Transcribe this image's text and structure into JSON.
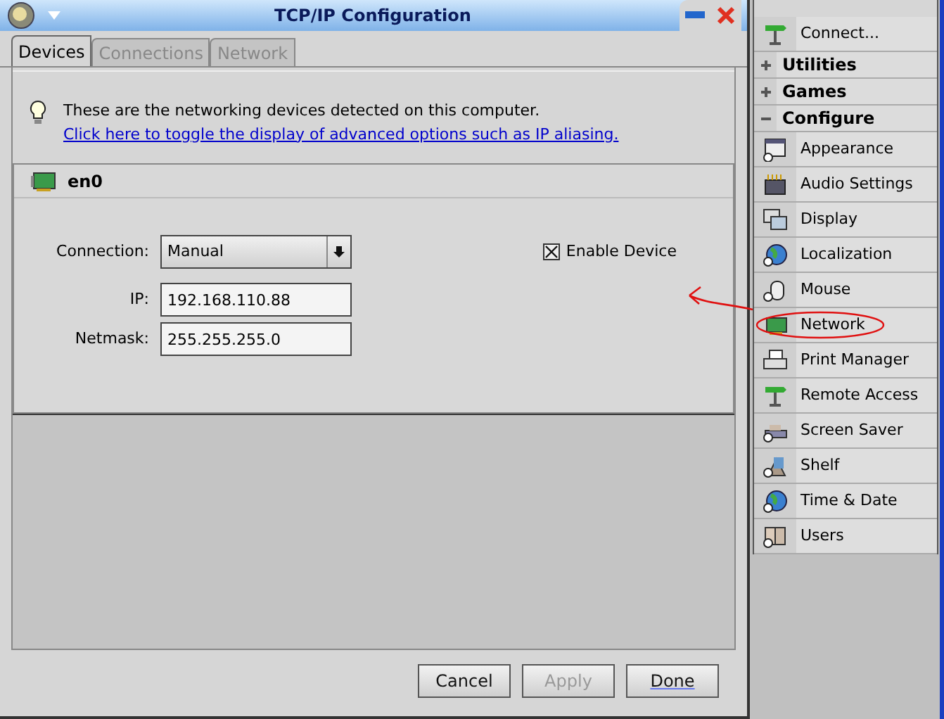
{
  "window": {
    "title": "TCP/IP Configuration"
  },
  "tabs": [
    {
      "label": "Devices",
      "selected": true
    },
    {
      "label": "Connections",
      "selected": false
    },
    {
      "label": "Network",
      "selected": false
    }
  ],
  "info": {
    "text": "These are the networking devices detected on this computer.",
    "link": "Click here to toggle the display of advanced options such as IP aliasing."
  },
  "device": {
    "name": "en0",
    "connection_label": "Connection:",
    "connection": "Manual",
    "enable_label": "Enable Device",
    "enabled": true,
    "fields": [
      {
        "label": "IP:",
        "value": "192.168.110.88"
      },
      {
        "label": "Netmask:",
        "value": "255.255.255.0"
      }
    ]
  },
  "buttons": [
    {
      "label": "Cancel",
      "disabled": false,
      "default": false
    },
    {
      "label": "Apply",
      "disabled": true,
      "default": false
    },
    {
      "label": "Done",
      "disabled": false,
      "default": true
    }
  ],
  "sidebar": {
    "items": [
      {
        "kind": "item",
        "label": "Connect..."
      },
      {
        "kind": "group",
        "label": "Utilities",
        "expanded": false
      },
      {
        "kind": "group",
        "label": "Games",
        "expanded": false
      },
      {
        "kind": "group",
        "label": "Configure",
        "expanded": true
      },
      {
        "kind": "item",
        "label": "Appearance"
      },
      {
        "kind": "item",
        "label": "Audio Settings"
      },
      {
        "kind": "item",
        "label": "Display"
      },
      {
        "kind": "item",
        "label": "Localization"
      },
      {
        "kind": "item",
        "label": "Mouse"
      },
      {
        "kind": "item",
        "label": "Network"
      },
      {
        "kind": "item",
        "label": "Print Manager"
      },
      {
        "kind": "item",
        "label": "Remote Access"
      },
      {
        "kind": "item",
        "label": "Screen Saver"
      },
      {
        "kind": "item",
        "label": "Shelf"
      },
      {
        "kind": "item",
        "label": "Time & Date"
      },
      {
        "kind": "item",
        "label": "Users"
      }
    ]
  }
}
